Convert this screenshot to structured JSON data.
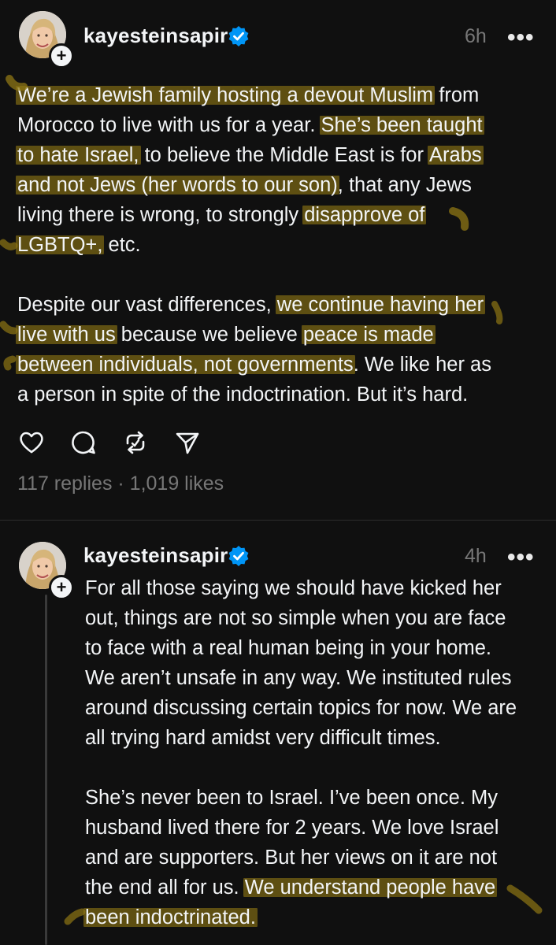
{
  "posts": [
    {
      "username": "kayesteinsapir",
      "time": "6h",
      "more": "•••",
      "follow": "+",
      "paragraphs": [
        [
          [
            {
              "t": "We’re a Jewish family hosting a devout Muslim",
              "h": true
            },
            {
              "t": " from"
            }
          ],
          [
            {
              "t": "Morocco to live with us for a year. "
            },
            {
              "t": "She’s been taught",
              "h": true
            }
          ],
          [
            {
              "t": "to hate Israel,",
              "h": true
            },
            {
              "t": " to believe the Middle East is for "
            },
            {
              "t": "Arabs",
              "h": true
            }
          ],
          [
            {
              "t": "and not Jews (her words to our son)",
              "h": true
            },
            {
              "t": ", that any Jews"
            }
          ],
          [
            {
              "t": "living there is wrong, to strongly "
            },
            {
              "t": "disapprove of",
              "h": true
            }
          ],
          [
            {
              "t": "LGBTQ+,",
              "h": true
            },
            {
              "t": " etc."
            }
          ]
        ],
        [
          [
            {
              "t": "Despite our vast differences, "
            },
            {
              "t": "we continue having her",
              "h": true
            }
          ],
          [
            {
              "t": "live with us",
              "h": true
            },
            {
              "t": " because we believe "
            },
            {
              "t": "peace is made",
              "h": true
            }
          ],
          [
            {
              "t": "between individuals, not governments",
              "h": true
            },
            {
              "t": ". We like her as"
            }
          ],
          [
            {
              "t": "a person in spite of the indoctrination. But it’s hard."
            }
          ]
        ]
      ],
      "actions": [
        "like",
        "reply",
        "repost",
        "share"
      ],
      "stats": "117 replies · 1,019 likes"
    },
    {
      "username": "kayesteinsapir",
      "time": "4h",
      "more": "•••",
      "follow": "+",
      "paragraphs": [
        [
          [
            {
              "t": "For all those saying we should have kicked her"
            }
          ],
          [
            {
              "t": "out, things are not so simple when you are face"
            }
          ],
          [
            {
              "t": "to face with a real human being in your home."
            }
          ],
          [
            {
              "t": "We aren’t unsafe in any way. We instituted rules"
            }
          ],
          [
            {
              "t": "around discussing certain topics for now. We are"
            }
          ],
          [
            {
              "t": "all trying hard amidst very difficult times."
            }
          ]
        ],
        [
          [
            {
              "t": "She’s never been to Israel. I’ve been once. My"
            }
          ],
          [
            {
              "t": "husband lived there for 2 years. We love Israel"
            }
          ],
          [
            {
              "t": "and are supporters. But her views on it are not"
            }
          ],
          [
            {
              "t": "the end all for us. "
            },
            {
              "t": "We understand people have",
              "h": true
            }
          ],
          [
            {
              "t": "been indoctrinated.",
              "h": true
            }
          ]
        ]
      ]
    }
  ],
  "colors": {
    "background": "#101010",
    "text": "#f3f5f7",
    "muted": "#777777",
    "verified": "#0095f6",
    "highlight": "#8e7614"
  },
  "icons": {
    "verified": "verified-badge-icon",
    "like": "heart-icon",
    "reply": "comment-icon",
    "repost": "repost-icon",
    "share": "send-icon",
    "more": "more-options-icon",
    "follow": "plus-icon"
  }
}
